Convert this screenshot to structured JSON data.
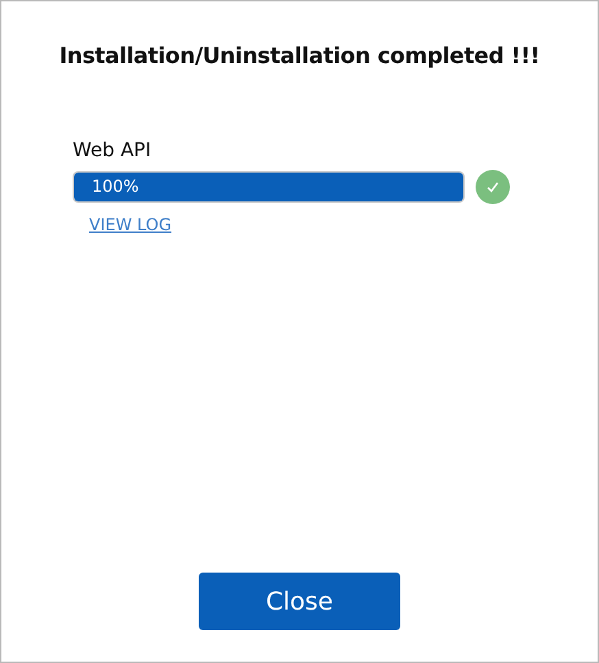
{
  "title": "Installation/Uninstallation completed !!!",
  "components": [
    {
      "name": "Web API",
      "level": 1,
      "reading": "100%",
      "completed": true,
      "link": "VIEW LOG"
    }
  ],
  "buttons": [
    "Close"
  ]
}
